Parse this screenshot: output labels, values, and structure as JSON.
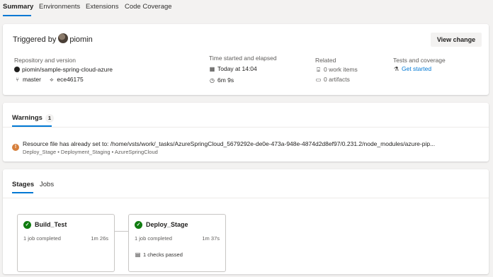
{
  "tabs": [
    "Summary",
    "Environments",
    "Extensions",
    "Code Coverage"
  ],
  "summary": {
    "triggered_prefix": "Triggered by",
    "user": "piomin",
    "view_change": "View change",
    "repo_label": "Repository and version",
    "repo": "piomin/sample-spring-cloud-azure",
    "branch": "master",
    "commit": "ece46175",
    "time_label": "Time started and elapsed",
    "started": "Today at 14:04",
    "elapsed": "6m 9s",
    "related_label": "Related",
    "work_items": "0 work items",
    "artifacts": "0 artifacts",
    "tests_label": "Tests and coverage",
    "get_started": "Get started"
  },
  "warnings": {
    "title": "Warnings",
    "count": "1",
    "message": "Resource file has already set to: /home/vsts/work/_tasks/AzureSpringCloud_5679292e-de0e-473a-948e-4874d2d8ef97/0.231.2/node_modules/azure-pip...",
    "path": "Deploy_Stage • Deployment_Staging • AzureSpringCloud"
  },
  "stages_section": {
    "tabs": [
      "Stages",
      "Jobs"
    ],
    "stages": [
      {
        "name": "Build_Test",
        "jobs": "1 job completed",
        "duration": "1m 26s",
        "checks": ""
      },
      {
        "name": "Deploy_Stage",
        "jobs": "1 job completed",
        "duration": "1m 37s",
        "checks": "1 checks passed"
      }
    ]
  },
  "colors": {
    "accent": "#0078d4",
    "success": "#107c10",
    "warning": "#d67f3c"
  }
}
